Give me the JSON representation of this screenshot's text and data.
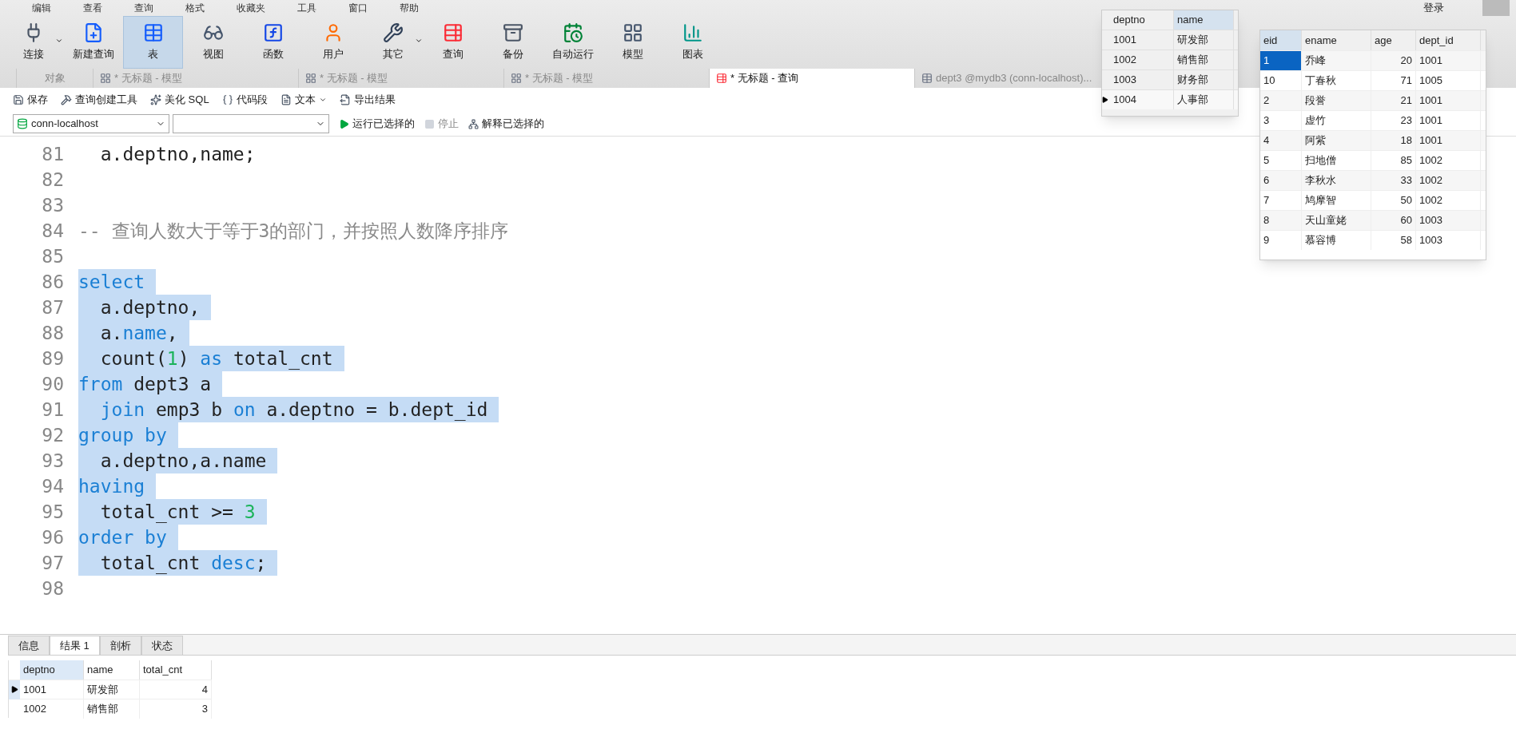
{
  "menu": [
    "编辑",
    "查看",
    "查询",
    "格式",
    "收藏夹",
    "工具",
    "窗口",
    "帮助"
  ],
  "account": {
    "label": "登录"
  },
  "toolbar": [
    {
      "label": "连接",
      "dropdown": true,
      "selected": false
    },
    {
      "label": "新建查询",
      "dropdown": false,
      "selected": false
    },
    {
      "label": "表",
      "dropdown": false,
      "selected": true
    },
    {
      "label": "视图",
      "dropdown": false,
      "selected": false
    },
    {
      "label": "函数",
      "dropdown": false,
      "selected": false
    },
    {
      "label": "用户",
      "dropdown": false,
      "selected": false
    },
    {
      "label": "其它",
      "dropdown": true,
      "selected": false
    },
    {
      "label": "查询",
      "dropdown": false,
      "selected": false
    },
    {
      "label": "备份",
      "dropdown": false,
      "selected": false
    },
    {
      "label": "自动运行",
      "dropdown": false,
      "selected": false
    },
    {
      "label": "模型",
      "dropdown": false,
      "selected": false
    },
    {
      "label": "图表",
      "dropdown": false,
      "selected": false
    }
  ],
  "tabs": [
    {
      "label": "对象",
      "selected": false
    },
    {
      "label": "* 无标题 - 模型",
      "selected": false
    },
    {
      "label": "* 无标题 - 模型",
      "selected": false
    },
    {
      "label": "* 无标题 - 模型",
      "selected": false
    },
    {
      "label": "* 无标题 - 查询",
      "selected": true
    },
    {
      "label": "dept3 @mydb3 (conn-localhost)...",
      "selected": false
    }
  ],
  "query_toolbar": [
    {
      "label": "保存",
      "dropdown": false
    },
    {
      "label": "查询创建工具",
      "dropdown": false
    },
    {
      "label": "美化 SQL",
      "dropdown": false
    },
    {
      "label": "代码段",
      "dropdown": false
    },
    {
      "label": "文本",
      "dropdown": true
    },
    {
      "label": "导出结果",
      "dropdown": false
    }
  ],
  "connection": {
    "value": "conn-localhost"
  },
  "run_actions": [
    {
      "label": "运行已选择的",
      "disabled": false
    },
    {
      "label": "停止",
      "disabled": true
    },
    {
      "label": "解释已选择的",
      "disabled": false
    }
  ],
  "editor_lines": [
    {
      "number": "81",
      "selected": false,
      "tokens": [
        {
          "kind": "plain",
          "text": "  a.deptno,name;"
        }
      ]
    },
    {
      "number": "82",
      "selected": false
    },
    {
      "number": "83",
      "selected": false
    },
    {
      "number": "84",
      "selected": false,
      "tokens": [
        {
          "kind": "comment",
          "text": "-- 查询人数大于等于3的部门，并按照人数降序排序"
        }
      ]
    },
    {
      "number": "85",
      "selected": false
    },
    {
      "number": "86",
      "selected": true,
      "tokens": [
        {
          "kind": "keyword",
          "text": "select"
        }
      ]
    },
    {
      "number": "87",
      "selected": true,
      "tokens": [
        {
          "kind": "plain",
          "text": "  a.deptno,"
        }
      ]
    },
    {
      "number": "88",
      "selected": true,
      "tokens": [
        {
          "kind": "plain",
          "text": "  a."
        },
        {
          "kind": "keyword",
          "text": "name"
        },
        {
          "kind": "plain",
          "text": ","
        }
      ]
    },
    {
      "number": "89",
      "selected": true,
      "tokens": [
        {
          "kind": "plain",
          "text": "  count("
        },
        {
          "kind": "number",
          "text": "1"
        },
        {
          "kind": "plain",
          "text": ") "
        },
        {
          "kind": "keyword",
          "text": "as"
        },
        {
          "kind": "plain",
          "text": " total_cnt"
        }
      ]
    },
    {
      "number": "90",
      "selected": true,
      "tokens": [
        {
          "kind": "keyword",
          "text": "from"
        },
        {
          "kind": "plain",
          "text": " dept3 a"
        }
      ]
    },
    {
      "number": "91",
      "selected": true,
      "tokens": [
        {
          "kind": "keyword",
          "text": "  join"
        },
        {
          "kind": "plain",
          "text": " emp3 b "
        },
        {
          "kind": "keyword",
          "text": "on"
        },
        {
          "kind": "plain",
          "text": " a.deptno = b.dept_id"
        }
      ]
    },
    {
      "number": "92",
      "selected": true,
      "tokens": [
        {
          "kind": "keyword",
          "text": "group by"
        }
      ]
    },
    {
      "number": "93",
      "selected": true,
      "tokens": [
        {
          "kind": "plain",
          "text": "  a.deptno,a.name"
        }
      ]
    },
    {
      "number": "94",
      "selected": true,
      "tokens": [
        {
          "kind": "keyword",
          "text": "having"
        }
      ]
    },
    {
      "number": "95",
      "selected": true,
      "tokens": [
        {
          "kind": "plain",
          "text": "  total_cnt >= "
        },
        {
          "kind": "number",
          "text": "3"
        }
      ]
    },
    {
      "number": "96",
      "selected": true,
      "tokens": [
        {
          "kind": "keyword",
          "text": "order by"
        }
      ]
    },
    {
      "number": "97",
      "selected": true,
      "tokens": [
        {
          "kind": "plain",
          "text": "  total_cnt "
        },
        {
          "kind": "keyword",
          "text": "desc"
        },
        {
          "kind": "plain",
          "text": ";"
        }
      ]
    },
    {
      "number": "98",
      "selected": false
    }
  ],
  "result_tabs": [
    {
      "label": "信息",
      "selected": false
    },
    {
      "label": "结果 1",
      "selected": true
    },
    {
      "label": "剖析",
      "selected": false
    },
    {
      "label": "状态",
      "selected": false
    }
  ],
  "result_grid": {
    "columns": [
      "deptno",
      "name",
      "total_cnt"
    ],
    "rows": [
      {
        "current": true,
        "cells": [
          "1001",
          "研发部",
          "4"
        ]
      },
      {
        "current": false,
        "cells": [
          "1002",
          "销售部",
          "3"
        ]
      }
    ]
  },
  "dept_table": {
    "columns": [
      "deptno",
      "name"
    ],
    "rows": [
      {
        "current": false,
        "cells": [
          "1001",
          "研发部"
        ]
      },
      {
        "current": false,
        "cells": [
          "1002",
          "销售部"
        ]
      },
      {
        "current": false,
        "cells": [
          "1003",
          "财务部"
        ]
      },
      {
        "current": true,
        "cells": [
          "1004",
          "人事部"
        ]
      }
    ]
  },
  "emp_table": {
    "columns": [
      "eid",
      "ename",
      "age",
      "dept_id"
    ],
    "rows": [
      {
        "selected": true,
        "cells": [
          "1",
          "乔峰",
          "20",
          "1001"
        ]
      },
      {
        "selected": false,
        "cells": [
          "10",
          "丁春秋",
          "71",
          "1005"
        ]
      },
      {
        "selected": false,
        "cells": [
          "2",
          "段誉",
          "21",
          "1001"
        ]
      },
      {
        "selected": false,
        "cells": [
          "3",
          "虚竹",
          "23",
          "1001"
        ]
      },
      {
        "selected": false,
        "cells": [
          "4",
          "阿紫",
          "18",
          "1001"
        ]
      },
      {
        "selected": false,
        "cells": [
          "5",
          "扫地僧",
          "85",
          "1002"
        ]
      },
      {
        "selected": false,
        "cells": [
          "6",
          "李秋水",
          "33",
          "1002"
        ]
      },
      {
        "selected": false,
        "cells": [
          "7",
          "鸠摩智",
          "50",
          "1002"
        ]
      },
      {
        "selected": false,
        "cells": [
          "8",
          "天山童姥",
          "60",
          "1003"
        ]
      },
      {
        "selected": false,
        "cells": [
          "9",
          "慕容博",
          "58",
          "1003"
        ]
      }
    ]
  }
}
